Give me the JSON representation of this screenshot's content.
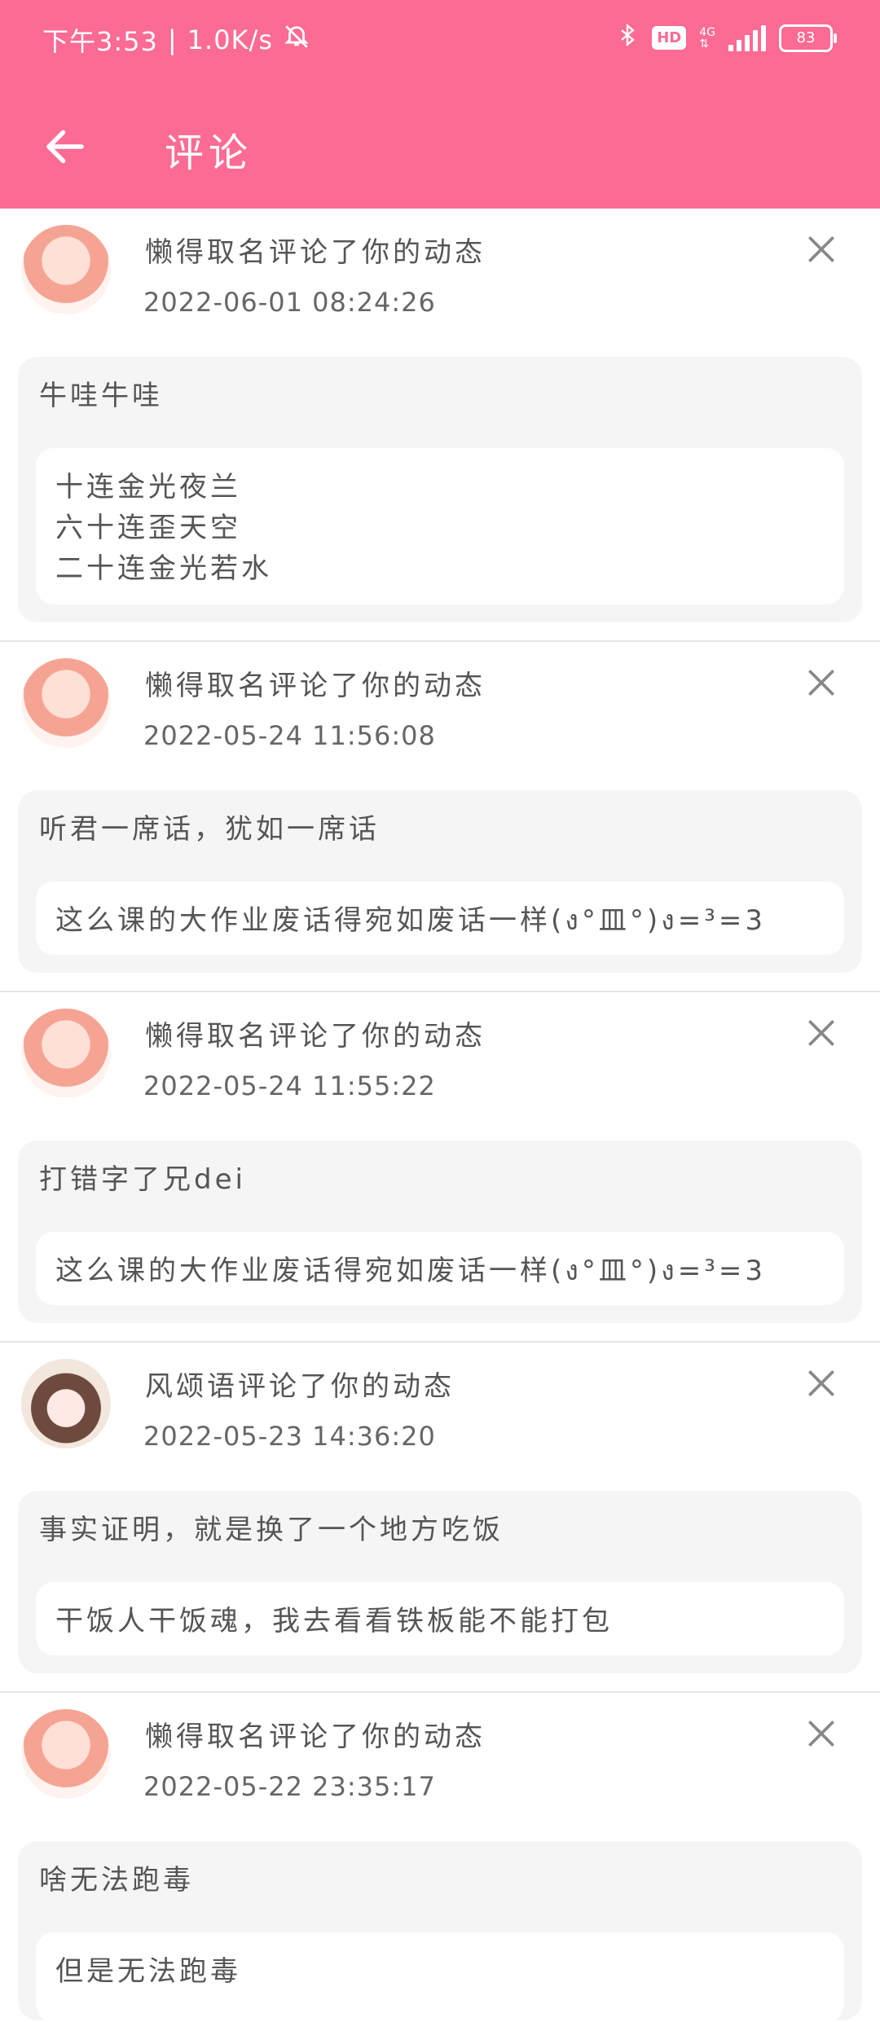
{
  "status_bar": {
    "time": "下午3:53",
    "speed": "1.0K/s",
    "hd": "HD",
    "network": "4G",
    "battery": "83",
    "icons": [
      "mute-icon",
      "bluetooth-icon",
      "hd-icon",
      "signal-icon",
      "battery-icon"
    ]
  },
  "header": {
    "title": "评论",
    "back_icon": "arrow-left-icon"
  },
  "items": [
    {
      "user_action": "懒得取名评论了你的动态",
      "time": "2022-06-01 08:24:26",
      "comment": "牛哇牛哇",
      "quote": [
        "十连金光夜兰",
        "六十连歪天空",
        "二十连金光若水"
      ]
    },
    {
      "user_action": "懒得取名评论了你的动态",
      "time": "2022-05-24 11:56:08",
      "comment": "听君一席话，犹如一席话",
      "quote": [
        "这么课的大作业废话得宛如废话一样(ง°皿°)ง=³=3"
      ]
    },
    {
      "user_action": "懒得取名评论了你的动态",
      "time": "2022-05-24 11:55:22",
      "comment": "打错字了兄dei",
      "quote": [
        "这么课的大作业废话得宛如废话一样(ง°皿°)ง=³=3"
      ]
    },
    {
      "user_action": "风颂语评论了你的动态",
      "time": "2022-05-23 14:36:20",
      "comment": "事实证明，就是换了一个地方吃饭",
      "quote": [
        "干饭人干饭魂，我去看看铁板能不能打包"
      ]
    },
    {
      "user_action": "懒得取名评论了你的动态",
      "time": "2022-05-22 23:35:17",
      "comment": "啥无法跑毒",
      "quote": [
        "但是无法跑毒"
      ]
    }
  ]
}
